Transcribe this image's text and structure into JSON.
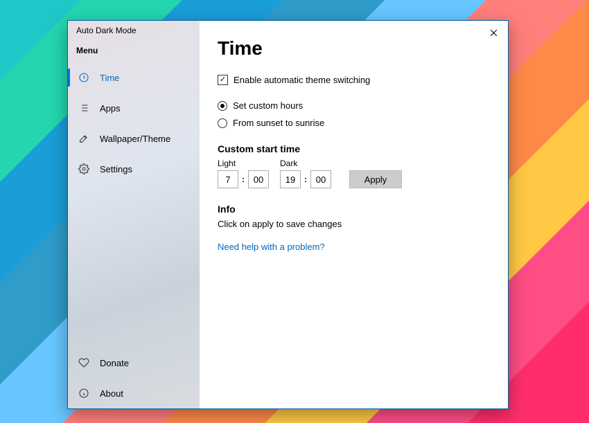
{
  "window_title": "Auto Dark Mode",
  "menu_header": "Menu",
  "sidebar": {
    "items": [
      {
        "label": "Time",
        "active": true
      },
      {
        "label": "Apps",
        "active": false
      },
      {
        "label": "Wallpaper/Theme",
        "active": false
      },
      {
        "label": "Settings",
        "active": false
      }
    ],
    "bottom": [
      {
        "label": "Donate"
      },
      {
        "label": "About"
      }
    ]
  },
  "page": {
    "title": "Time",
    "enable_checkbox_label": "Enable automatic theme switching",
    "enable_checkbox_checked": true,
    "radio": {
      "custom_label": "Set custom hours",
      "sunset_label": "From sunset to sunrise",
      "selected": "custom"
    },
    "custom_section_title": "Custom start time",
    "light_label": "Light",
    "dark_label": "Dark",
    "light_hour": "7",
    "light_min": "00",
    "dark_hour": "19",
    "dark_min": "00",
    "apply_label": "Apply",
    "info_title": "Info",
    "info_text": "Click on apply to save changes",
    "help_link": "Need help with a problem?"
  }
}
